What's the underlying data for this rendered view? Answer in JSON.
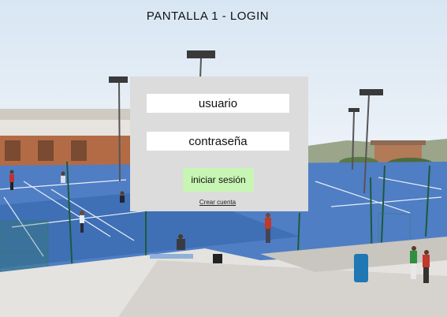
{
  "page": {
    "title": "PANTALLA 1 - LOGIN"
  },
  "login": {
    "username_placeholder": "usuario",
    "password_placeholder": "contraseña",
    "submit_label": "iniciar sesión",
    "create_account_label": "Crear cuenta"
  },
  "colors": {
    "panel_background": "#dcdcdc",
    "button_background": "#c7f5b3",
    "court_blue": "#4f7ec4"
  },
  "background": {
    "description_icon": "tennis-courts-photo"
  }
}
